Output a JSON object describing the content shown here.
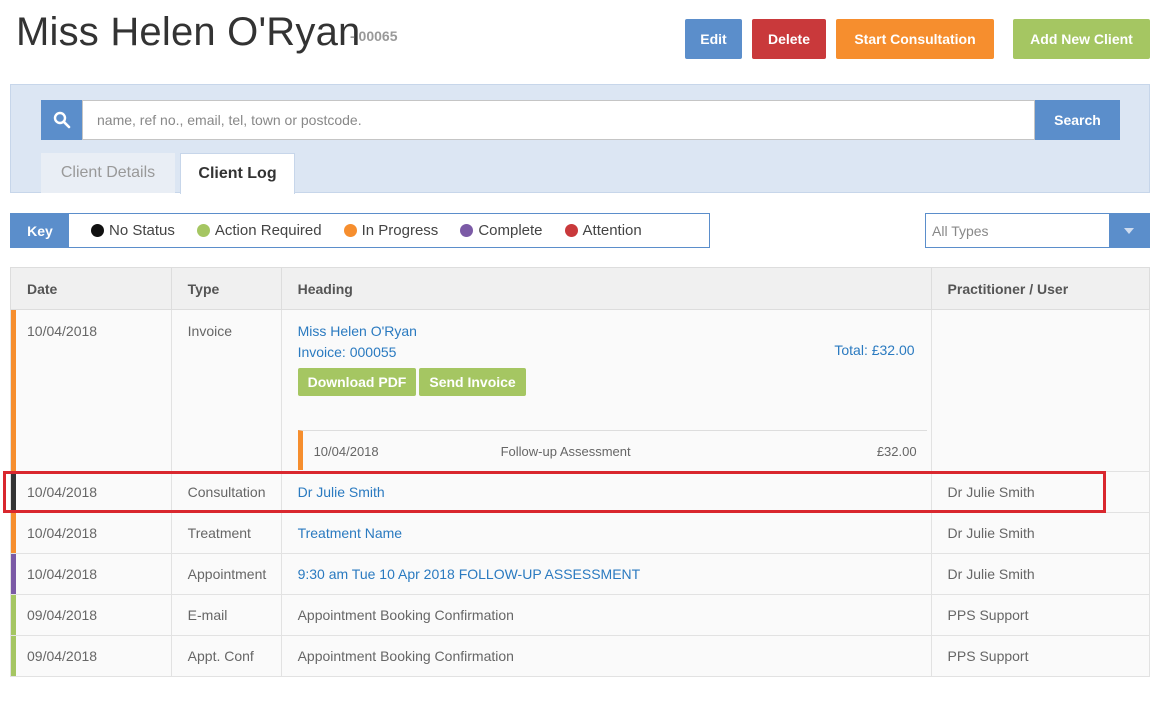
{
  "header": {
    "title": "Miss Helen O'Ryan",
    "client_ref": "- 00065",
    "buttons": {
      "edit": "Edit",
      "delete": "Delete",
      "start_consultation": "Start Consultation",
      "add_new_client": "Add New Client"
    }
  },
  "search": {
    "placeholder": "name, ref no., email, tel, town or postcode.",
    "button": "Search"
  },
  "tabs": [
    {
      "label": "Client Details",
      "active": false
    },
    {
      "label": "Client Log",
      "active": true
    }
  ],
  "key": {
    "label": "Key",
    "items": [
      {
        "label": "No Status",
        "color": "#111111"
      },
      {
        "label": "Action Required",
        "color": "#a5c662"
      },
      {
        "label": "In Progress",
        "color": "#f68e2e"
      },
      {
        "label": "Complete",
        "color": "#7b5aa6"
      },
      {
        "label": "Attention",
        "color": "#c9393b"
      }
    ]
  },
  "type_filter": {
    "selected": "All Types"
  },
  "table": {
    "columns": [
      "Date",
      "Type",
      "Heading",
      "Practitioner / User"
    ],
    "invoice_row": {
      "date": "10/04/2018",
      "type": "Invoice",
      "client_name": "Miss Helen O'Ryan",
      "invoice_no": "Invoice: 000055",
      "total": "Total: £32.00",
      "download_pdf": "Download PDF",
      "send_invoice": "Send Invoice",
      "line_date": "10/04/2018",
      "line_desc": "Follow-up Assessment",
      "line_amount": "£32.00",
      "practitioner": "",
      "status_color": "#f68e2e"
    },
    "rows": [
      {
        "date": "10/04/2018",
        "type": "Consultation",
        "heading": "Dr Julie Smith",
        "practitioner": "Dr Julie Smith",
        "status_color": "#333333"
      },
      {
        "date": "10/04/2018",
        "type": "Treatment",
        "heading": "Treatment Name",
        "practitioner": "Dr Julie Smith",
        "status_color": "#f68e2e"
      },
      {
        "date": "10/04/2018",
        "type": "Appointment",
        "heading": "9:30 am Tue 10 Apr 2018 FOLLOW-UP ASSESSMENT",
        "practitioner": "Dr Julie Smith",
        "status_color": "#7b5aa6"
      },
      {
        "date": "09/04/2018",
        "type": "E-mail",
        "heading": "Appointment Booking Confirmation",
        "practitioner": "PPS Support",
        "status_color": "#a5c662"
      },
      {
        "date": "09/04/2018",
        "type": "Appt. Conf",
        "heading": "Appointment Booking Confirmation",
        "practitioner": "PPS Support",
        "status_color": "#a5c662"
      }
    ]
  },
  "colors": {
    "primary": "#5b8ecb",
    "danger": "#c9393b",
    "warning": "#f68e2e",
    "success": "#a5c662",
    "link": "#2a7ac0",
    "highlight": "#d9272e"
  }
}
